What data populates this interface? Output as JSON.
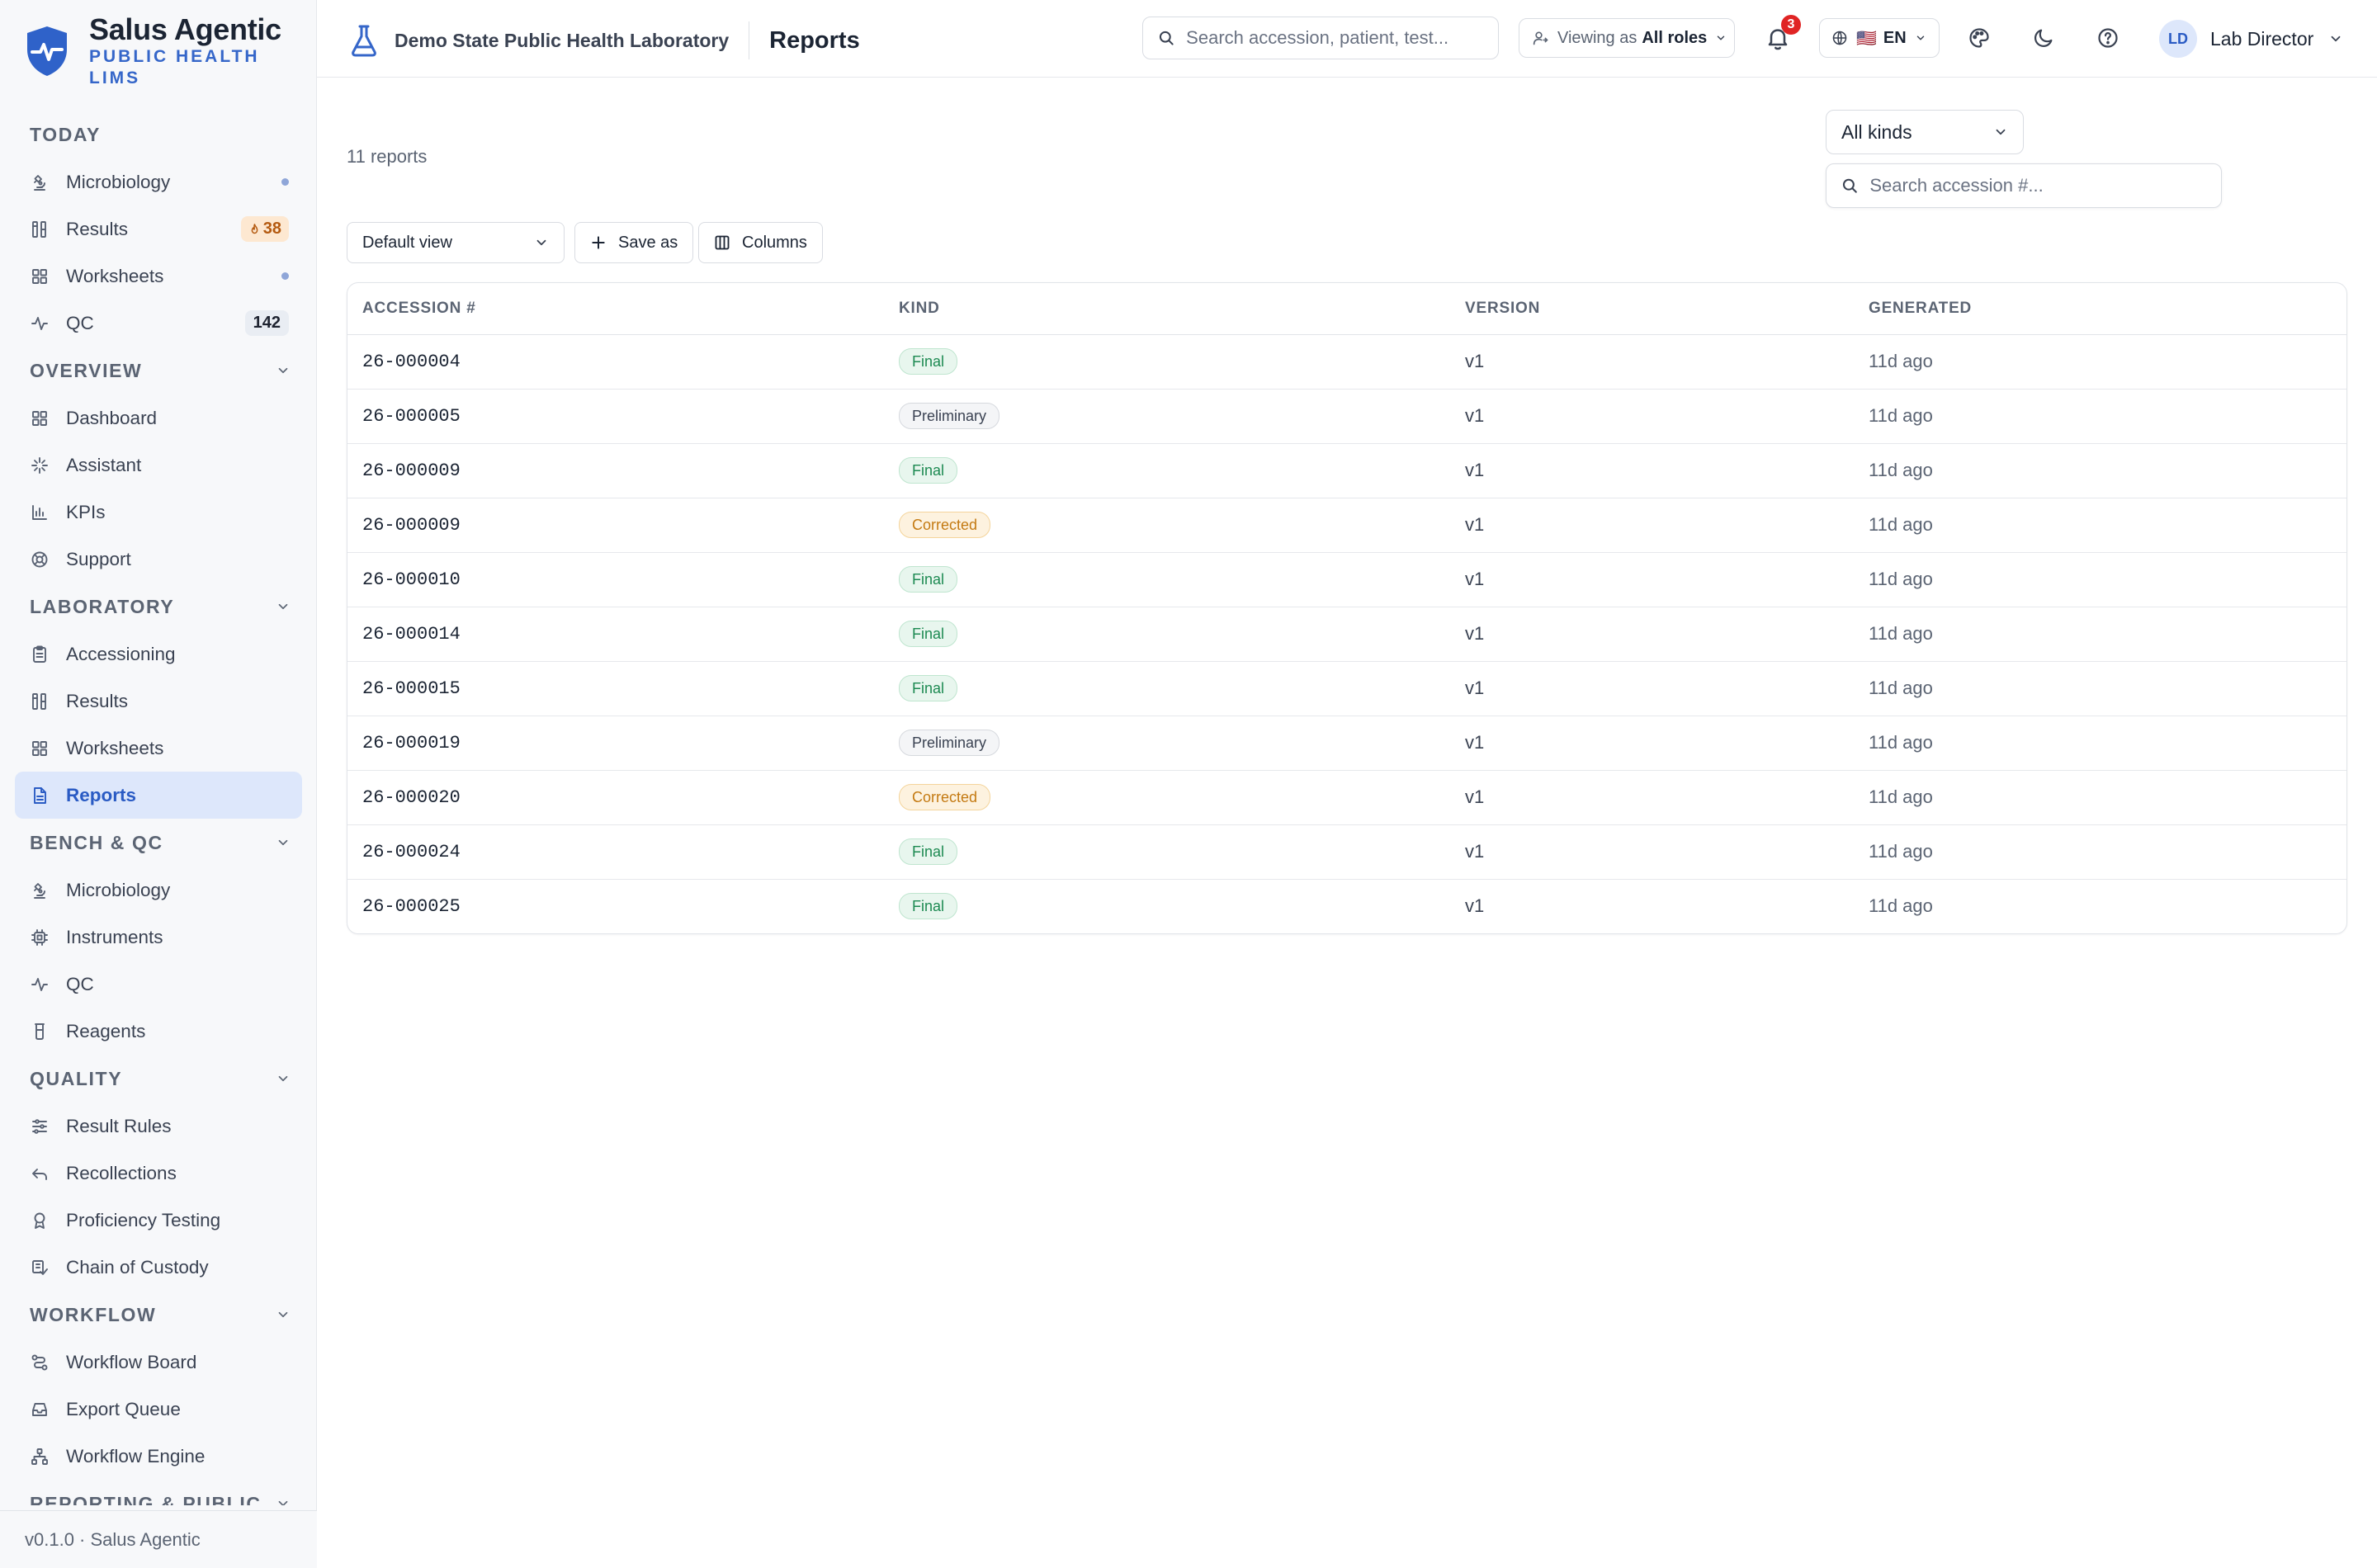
{
  "brand": {
    "name": "Salus Agentic",
    "subtitle": "PUBLIC HEALTH LIMS"
  },
  "sidebar": {
    "sections": [
      {
        "title": "TODAY",
        "collapsible": false,
        "items": [
          {
            "label": "Microbiology",
            "icon": "microscope-icon",
            "indicator": "dot"
          },
          {
            "label": "Results",
            "icon": "results-icon",
            "badge": "38",
            "badge_icon": "flame-icon"
          },
          {
            "label": "Worksheets",
            "icon": "grid-icon",
            "indicator": "dot"
          },
          {
            "label": "QC",
            "icon": "pulse-icon",
            "count": "142"
          }
        ]
      },
      {
        "title": "OVERVIEW",
        "collapsible": true,
        "items": [
          {
            "label": "Dashboard",
            "icon": "grid-icon"
          },
          {
            "label": "Assistant",
            "icon": "sparkle-icon"
          },
          {
            "label": "KPIs",
            "icon": "bar-chart-icon"
          },
          {
            "label": "Support",
            "icon": "lifebuoy-icon"
          }
        ]
      },
      {
        "title": "LABORATORY",
        "collapsible": true,
        "items": [
          {
            "label": "Accessioning",
            "icon": "clipboard-icon"
          },
          {
            "label": "Results",
            "icon": "results-icon"
          },
          {
            "label": "Worksheets",
            "icon": "grid-icon"
          },
          {
            "label": "Reports",
            "icon": "document-icon",
            "active": true
          }
        ]
      },
      {
        "title": "BENCH & QC",
        "collapsible": true,
        "items": [
          {
            "label": "Microbiology",
            "icon": "microscope-icon"
          },
          {
            "label": "Instruments",
            "icon": "cpu-icon"
          },
          {
            "label": "QC",
            "icon": "pulse-icon"
          },
          {
            "label": "Reagents",
            "icon": "beaker-icon"
          }
        ]
      },
      {
        "title": "QUALITY",
        "collapsible": true,
        "items": [
          {
            "label": "Result Rules",
            "icon": "sliders-icon"
          },
          {
            "label": "Recollections",
            "icon": "undo-icon"
          },
          {
            "label": "Proficiency Testing",
            "icon": "award-icon"
          },
          {
            "label": "Chain of Custody",
            "icon": "custody-icon"
          }
        ]
      },
      {
        "title": "WORKFLOW",
        "collapsible": true,
        "items": [
          {
            "label": "Workflow Board",
            "icon": "route-icon"
          },
          {
            "label": "Export Queue",
            "icon": "inbox-icon"
          },
          {
            "label": "Workflow Engine",
            "icon": "network-icon"
          }
        ]
      },
      {
        "title": "REPORTING & PUBLIC",
        "collapsible": true,
        "items": []
      }
    ],
    "footer": "v0.1.0 · Salus Agentic"
  },
  "topbar": {
    "org_name": "Demo State Public Health Laboratory",
    "page_title": "Reports",
    "search_placeholder": "Search accession, patient, test...",
    "viewing_label": "Viewing as",
    "viewing_value": "All roles",
    "notification_count": "3",
    "language": "EN",
    "language_flag": "🇺🇸",
    "user_initials": "LD",
    "user_name": "Lab Director"
  },
  "main": {
    "report_count": "11 reports",
    "kind_filter": "All kinds",
    "accession_search_placeholder": "Search accession #...",
    "view_select": "Default view",
    "save_as_label": "Save as",
    "columns_label": "Columns",
    "table": {
      "headers": [
        "ACCESSION #",
        "KIND",
        "VERSION",
        "GENERATED"
      ],
      "rows": [
        {
          "accession": "26-000004",
          "kind": "Final",
          "version": "v1",
          "generated": "11d ago"
        },
        {
          "accession": "26-000005",
          "kind": "Preliminary",
          "version": "v1",
          "generated": "11d ago"
        },
        {
          "accession": "26-000009",
          "kind": "Final",
          "version": "v1",
          "generated": "11d ago"
        },
        {
          "accession": "26-000009",
          "kind": "Corrected",
          "version": "v1",
          "generated": "11d ago"
        },
        {
          "accession": "26-000010",
          "kind": "Final",
          "version": "v1",
          "generated": "11d ago"
        },
        {
          "accession": "26-000014",
          "kind": "Final",
          "version": "v1",
          "generated": "11d ago"
        },
        {
          "accession": "26-000015",
          "kind": "Final",
          "version": "v1",
          "generated": "11d ago"
        },
        {
          "accession": "26-000019",
          "kind": "Preliminary",
          "version": "v1",
          "generated": "11d ago"
        },
        {
          "accession": "26-000020",
          "kind": "Corrected",
          "version": "v1",
          "generated": "11d ago"
        },
        {
          "accession": "26-000024",
          "kind": "Final",
          "version": "v1",
          "generated": "11d ago"
        },
        {
          "accession": "26-000025",
          "kind": "Final",
          "version": "v1",
          "generated": "11d ago"
        }
      ]
    }
  },
  "colors": {
    "accent": "#2a5bc4",
    "final": "#1d8a52",
    "preliminary": "#3a4252",
    "corrected": "#c47a12",
    "notification": "#e02424"
  }
}
